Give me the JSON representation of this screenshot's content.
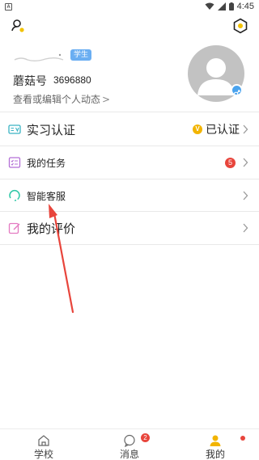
{
  "status_bar": {
    "notification_glyph": "A",
    "time": "4:45"
  },
  "profile": {
    "badge": "学生",
    "mogu_label": "蘑菇号",
    "mogu_id": "3696880",
    "edit_link": "查看或编辑个人动态",
    "edit_chevron": ">"
  },
  "menu": {
    "internship_cert": {
      "label": "实习认证",
      "badge_glyph": "V",
      "status": "已认证"
    },
    "my_tasks": {
      "label": "我的任务",
      "count": "5"
    },
    "customer_service": {
      "label": "智能客服"
    },
    "my_reviews": {
      "label": "我的评价"
    }
  },
  "bottom_nav": {
    "school": "学校",
    "messages": "消息",
    "messages_badge": "2",
    "mine": "我的"
  },
  "colors": {
    "student_badge": "#6aaef2",
    "verified_badge": "#f2b400",
    "alert_red": "#e8453c",
    "active_tab": "#f2b400",
    "annotation_arrow": "#e8453c"
  },
  "icons": {
    "top_left": "user-search-icon",
    "top_right": "hexagon-settings-icon",
    "internship_cert": "id-card-icon",
    "my_tasks": "task-list-icon",
    "customer_service": "headset-loop-icon",
    "my_reviews": "edit-review-icon",
    "school": "school-house-icon",
    "messages": "chat-bubble-icon",
    "mine": "person-icon"
  }
}
